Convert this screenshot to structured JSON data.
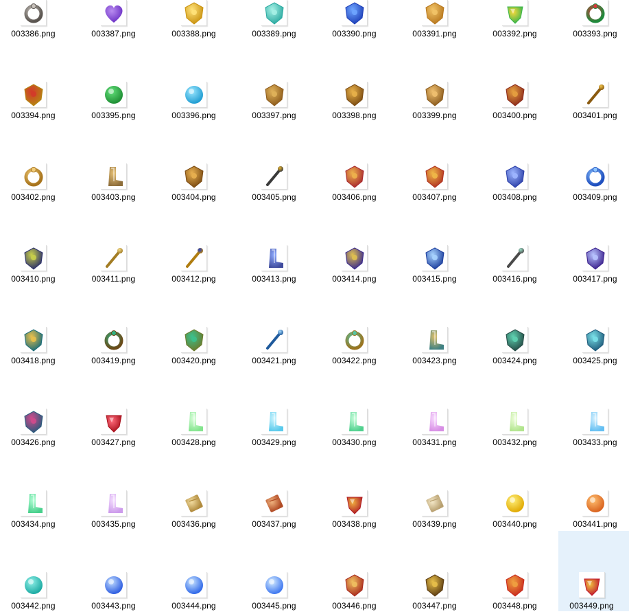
{
  "files": [
    {
      "name": "003386.png",
      "icon": "horseshoe-icon",
      "c1": "#5a5550",
      "c2": "#c8c2bc"
    },
    {
      "name": "003387.png",
      "icon": "heart-icon",
      "c1": "#6a2fc4",
      "c2": "#b98cf0"
    },
    {
      "name": "003388.png",
      "icon": "gold-charm-icon",
      "c1": "#c9920f",
      "c2": "#ffe27a"
    },
    {
      "name": "003389.png",
      "icon": "jade-token-icon",
      "c1": "#2aa9a0",
      "c2": "#a6f1e6"
    },
    {
      "name": "003390.png",
      "icon": "blue-potion-icon",
      "c1": "#1d3fb8",
      "c2": "#6fa5ff"
    },
    {
      "name": "003391.png",
      "icon": "amber-shell-icon",
      "c1": "#b7771d",
      "c2": "#f2c468"
    },
    {
      "name": "003392.png",
      "icon": "rainbow-gem-icon",
      "c1": "#3ab54a",
      "c2": "#f7d83c"
    },
    {
      "name": "003393.png",
      "icon": "jade-pendant-icon",
      "c1": "#1f8a3c",
      "c2": "#d33a3a"
    },
    {
      "name": "003394.png",
      "icon": "gold-medallion-icon",
      "c1": "#b58512",
      "c2": "#d33a2a"
    },
    {
      "name": "003395.png",
      "icon": "jade-disc-icon",
      "c1": "#1d8c32",
      "c2": "#62e07a"
    },
    {
      "name": "003396.png",
      "icon": "cyan-orb-icon",
      "c1": "#1d9bd1",
      "c2": "#9be7ff"
    },
    {
      "name": "003397.png",
      "icon": "bells-icon",
      "c1": "#8c5a1a",
      "c2": "#e0b25a"
    },
    {
      "name": "003398.png",
      "icon": "gold-gauntlet-icon",
      "c1": "#7a4a10",
      "c2": "#e8b14a"
    },
    {
      "name": "003399.png",
      "icon": "gold-claw-icon",
      "c1": "#8a5a1c",
      "c2": "#f0c070"
    },
    {
      "name": "003400.png",
      "icon": "crimson-helmet-icon",
      "c1": "#8c2a1a",
      "c2": "#e6a040"
    },
    {
      "name": "003401.png",
      "icon": "gold-rod-icon",
      "c1": "#8a5a10",
      "c2": "#f0c44a"
    },
    {
      "name": "003402.png",
      "icon": "gold-coil-icon",
      "c1": "#a8741c",
      "c2": "#f2cd7a"
    },
    {
      "name": "003403.png",
      "icon": "gold-boots-icon",
      "c1": "#7a5418",
      "c2": "#e4b860"
    },
    {
      "name": "003404.png",
      "icon": "gold-armor-icon",
      "c1": "#7a4a12",
      "c2": "#e8b050"
    },
    {
      "name": "003405.png",
      "icon": "gold-pickaxe-icon",
      "c1": "#3a3a3a",
      "c2": "#e6b430"
    },
    {
      "name": "003406.png",
      "icon": "ruby-crown-icon",
      "c1": "#a8282e",
      "c2": "#eeb24c"
    },
    {
      "name": "003407.png",
      "icon": "ruby-helm-icon",
      "c1": "#b03020",
      "c2": "#f0b848"
    },
    {
      "name": "003408.png",
      "icon": "blue-claw-icon",
      "c1": "#2b3fa8",
      "c2": "#9eb6ff"
    },
    {
      "name": "003409.png",
      "icon": "blue-ring-icon",
      "c1": "#1f4fbf",
      "c2": "#8ec6ff"
    },
    {
      "name": "003410.png",
      "icon": "horned-mask-icon",
      "c1": "#2b2f6a",
      "c2": "#c9d04a"
    },
    {
      "name": "003411.png",
      "icon": "gold-staff-icon",
      "c1": "#a37d24",
      "c2": "#f3da8a"
    },
    {
      "name": "003412.png",
      "icon": "crescent-blade-icon",
      "c1": "#b07d10",
      "c2": "#2742c4"
    },
    {
      "name": "003413.png",
      "icon": "blue-greaves-icon",
      "c1": "#1f2d8c",
      "c2": "#7a9cff"
    },
    {
      "name": "003414.png",
      "icon": "violet-pauldron-icon",
      "c1": "#3a2a8c",
      "c2": "#e0c050"
    },
    {
      "name": "003415.png",
      "icon": "blue-armor-icon",
      "c1": "#1a3c9c",
      "c2": "#a8d4ff"
    },
    {
      "name": "003416.png",
      "icon": "steel-pickaxe-icon",
      "c1": "#4a4a4a",
      "c2": "#9ae0c8"
    },
    {
      "name": "003417.png",
      "icon": "violet-armor-icon",
      "c1": "#3a1f8c",
      "c2": "#b8c4ff"
    },
    {
      "name": "003418.png",
      "icon": "teal-gauntlet-icon",
      "c1": "#1a6c78",
      "c2": "#e8c04c"
    },
    {
      "name": "003419.png",
      "icon": "emerald-ring-icon",
      "c1": "#6a4a18",
      "c2": "#30b080"
    },
    {
      "name": "003420.png",
      "icon": "emerald-crest-icon",
      "c1": "#6a7a2c",
      "c2": "#3cc08c"
    },
    {
      "name": "003421.png",
      "icon": "blue-spear-icon",
      "c1": "#1f5a9c",
      "c2": "#a8dcff"
    },
    {
      "name": "003422.png",
      "icon": "gold-necklace-icon",
      "c1": "#9a7420",
      "c2": "#56c4a4"
    },
    {
      "name": "003423.png",
      "icon": "teal-boots-icon",
      "c1": "#1c6a6c",
      "c2": "#e0b850"
    },
    {
      "name": "003424.png",
      "icon": "teal-belt-icon",
      "c1": "#244a44",
      "c2": "#5ed0b0"
    },
    {
      "name": "003425.png",
      "icon": "teal-chestplate-icon",
      "c1": "#1e5a7a",
      "c2": "#7ae0e8"
    },
    {
      "name": "003426.png",
      "icon": "teal-armor-icon",
      "c1": "#2a5a7c",
      "c2": "#d04a8c"
    },
    {
      "name": "003427.png",
      "icon": "ruby-gem-icon",
      "c1": "#a8101c",
      "c2": "#ff6a7a"
    },
    {
      "name": "003428.png",
      "icon": "green-boot-icon",
      "c1": "#6ee07a",
      "c2": "#d8ffd8"
    },
    {
      "name": "003429.png",
      "icon": "cyan-boot-icon",
      "c1": "#3cc0e8",
      "c2": "#c8f4ff"
    },
    {
      "name": "003430.png",
      "icon": "green-boot-icon",
      "c1": "#30c87a",
      "c2": "#c4ffd8"
    },
    {
      "name": "003431.png",
      "icon": "pink-boot-icon",
      "c1": "#d07ae0",
      "c2": "#f8d8ff"
    },
    {
      "name": "003432.png",
      "icon": "lime-boot-icon",
      "c1": "#a4e07a",
      "c2": "#eeffd8"
    },
    {
      "name": "003433.png",
      "icon": "cyan-boot-icon",
      "c1": "#48b4f0",
      "c2": "#d4f0ff"
    },
    {
      "name": "003434.png",
      "icon": "emerald-boot-icon",
      "c1": "#28c878",
      "c2": "#aaffd0"
    },
    {
      "name": "003435.png",
      "icon": "lilac-boot-icon",
      "c1": "#c48ae8",
      "c2": "#f4dcff"
    },
    {
      "name": "003436.png",
      "icon": "scroll-icon",
      "c1": "#b08a3c",
      "c2": "#f2dca0"
    },
    {
      "name": "003437.png",
      "icon": "red-scroll-icon",
      "c1": "#b04a24",
      "c2": "#f0b480"
    },
    {
      "name": "003438.png",
      "icon": "ruby-shield-gem-icon",
      "c1": "#b01c24",
      "c2": "#f0b040"
    },
    {
      "name": "003439.png",
      "icon": "parchment-scroll-icon",
      "c1": "#b8a070",
      "c2": "#f4e8c8"
    },
    {
      "name": "003440.png",
      "icon": "yellow-orb-icon",
      "c1": "#e0a800",
      "c2": "#fff07a"
    },
    {
      "name": "003441.png",
      "icon": "orange-orb-icon",
      "c1": "#d8601c",
      "c2": "#ffc070"
    },
    {
      "name": "003442.png",
      "icon": "teal-orb-icon",
      "c1": "#18a8a0",
      "c2": "#90f0e8"
    },
    {
      "name": "003443.png",
      "icon": "blue-vortex-icon",
      "c1": "#2a5ae0",
      "c2": "#c0dcff"
    },
    {
      "name": "003444.png",
      "icon": "blue-vortex-icon",
      "c1": "#2a64e8",
      "c2": "#c8e4ff"
    },
    {
      "name": "003445.png",
      "icon": "blue-vortex-icon",
      "c1": "#3a74f0",
      "c2": "#d4ecff"
    },
    {
      "name": "003446.png",
      "icon": "dragon-armor-icon",
      "c1": "#a8281c",
      "c2": "#f0c060"
    },
    {
      "name": "003447.png",
      "icon": "dragon-crown-icon",
      "c1": "#5a3a10",
      "c2": "#e8c04a"
    },
    {
      "name": "003448.png",
      "icon": "dragon-helm-icon",
      "c1": "#c8281c",
      "c2": "#f0a040"
    },
    {
      "name": "003449.png",
      "icon": "ruby-amulet-icon",
      "c1": "#c0182c",
      "c2": "#f0c040"
    }
  ],
  "selected_file": "003449.png"
}
